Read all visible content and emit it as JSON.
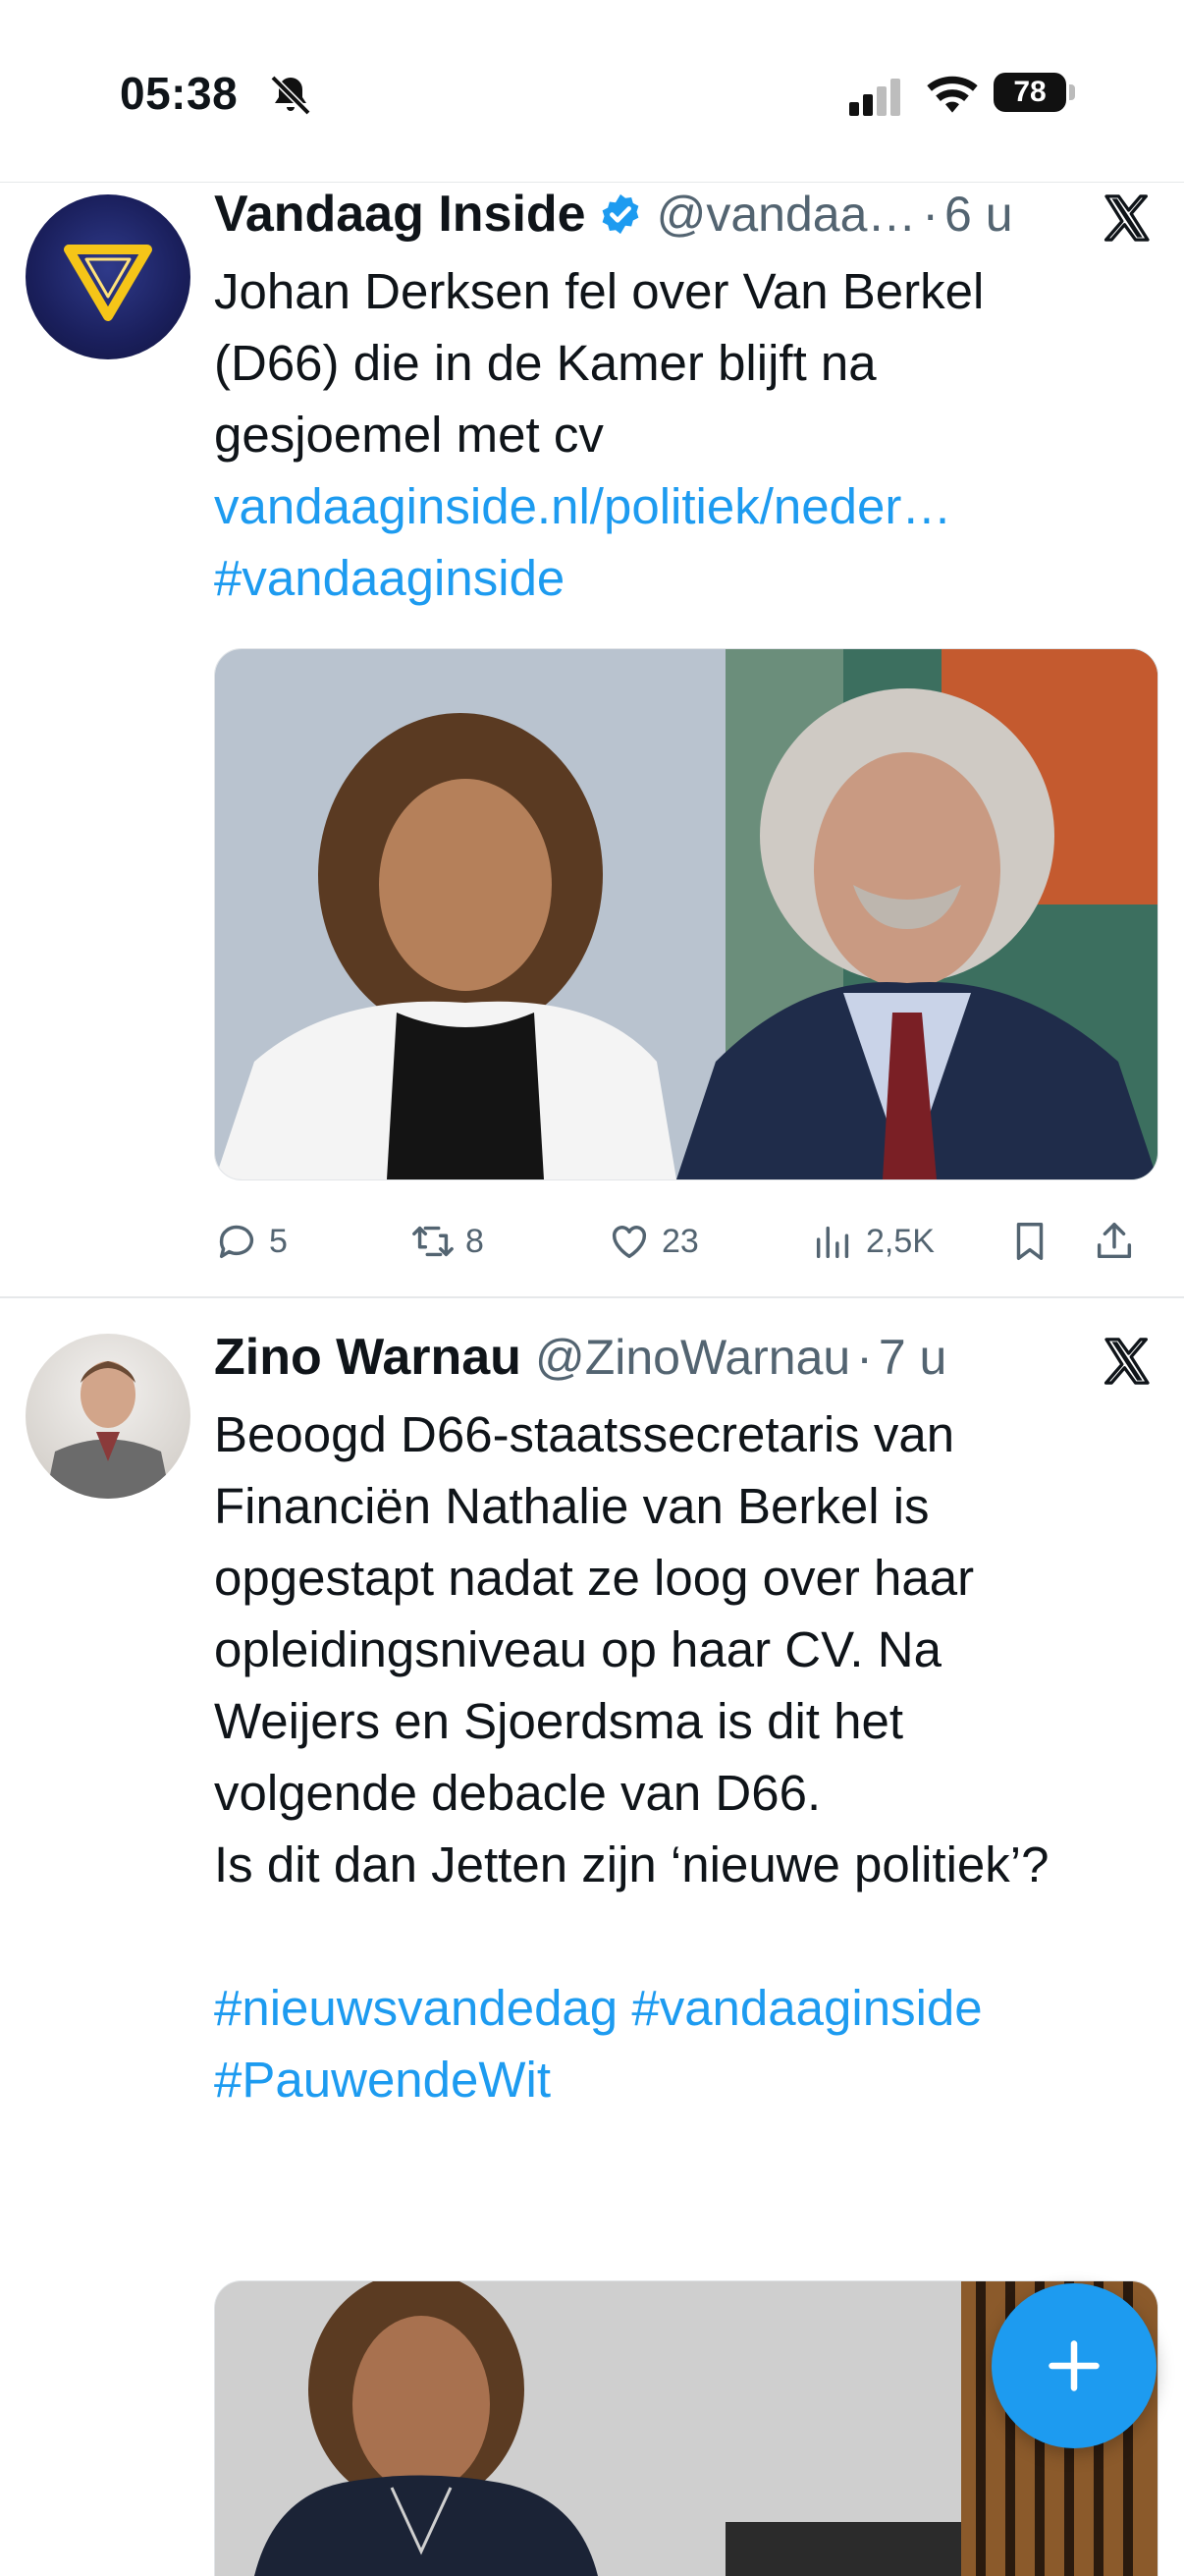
{
  "status_bar": {
    "time": "05:38",
    "battery": "78"
  },
  "tweets": [
    {
      "author_name": "Vandaag Inside",
      "handle": "@vandaa…",
      "separator": "·",
      "time": "6 u",
      "lines": [
        "Johan Derksen fel over Van Berkel",
        "(D66) die in de Kamer blijft na",
        "gesjoemel met cv"
      ],
      "link": "vandaaginside.nl/politiek/neder…",
      "hashtag": "#vandaaginside",
      "replies": "5",
      "retweets": "8",
      "likes": "23",
      "views": "2,5K"
    },
    {
      "author_name": "Zino Warnau",
      "handle": "@ZinoWarnau",
      "separator": "·",
      "time": "7 u",
      "lines": [
        "Beoogd D66-staatssecretaris van",
        "Financiën Nathalie van Berkel is",
        "opgestapt nadat ze loog over haar",
        "opleidingsniveau op haar CV. Na",
        "Weijers en Sjoerdsma is dit het",
        "volgende debacle van D66.",
        "Is dit dan Jetten zijn ‘nieuwe politiek’?"
      ],
      "hashtags_line1": "#nieuwsvandedag #vandaaginside",
      "hashtags_line2": "#PauwendeWit"
    }
  ],
  "colors": {
    "link": "#1d9bf0",
    "secondary_text": "#536471",
    "primary_text": "#0f1419",
    "fab": "#1d9bf0"
  },
  "icons": [
    "bell-slash-icon",
    "signal-icon",
    "wifi-icon",
    "battery-icon",
    "verified-badge-icon",
    "x-logo-icon",
    "reply-icon",
    "retweet-icon",
    "like-icon",
    "views-icon",
    "bookmark-icon",
    "share-icon",
    "plus-icon"
  ]
}
